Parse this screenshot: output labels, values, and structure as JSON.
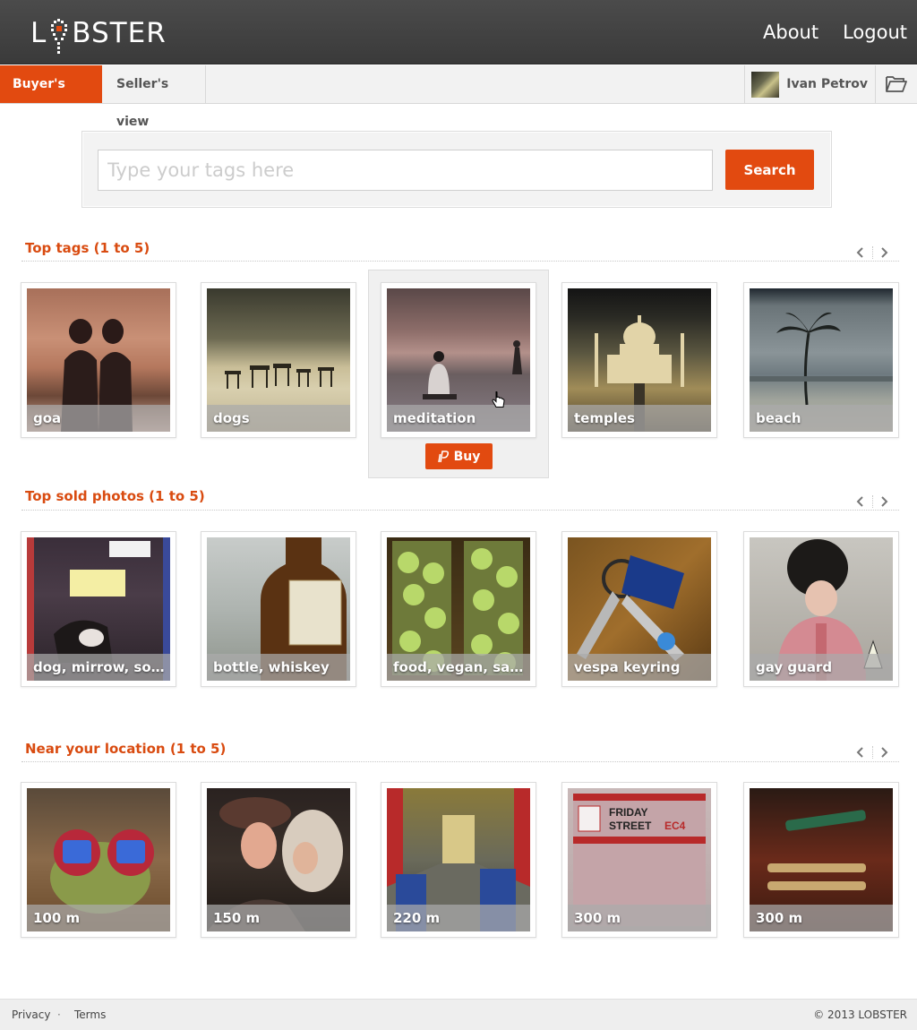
{
  "header": {
    "logo_text_left": "L",
    "logo_text_right": "BSTER",
    "nav": [
      {
        "label": "About"
      },
      {
        "label": "Logout"
      }
    ]
  },
  "tabs": {
    "buyer_label": "Buyer's view",
    "seller_label": "Seller's view"
  },
  "user": {
    "name": "Ivan Petrov"
  },
  "search": {
    "placeholder": "Type your tags here",
    "value": "",
    "button_label": "Search"
  },
  "accent_color": "#e24a10",
  "sections": [
    {
      "title": "Top tags (1 to 5)",
      "items": [
        {
          "caption": "goa"
        },
        {
          "caption": "dogs"
        },
        {
          "caption": "meditation"
        },
        {
          "caption": "temples"
        },
        {
          "caption": "beach"
        }
      ]
    },
    {
      "title": "Top sold photos (1 to 5)",
      "items": [
        {
          "caption": "dog, mirrow, sorr..."
        },
        {
          "caption": "bottle, whiskey"
        },
        {
          "caption": "food, vegan, sand..."
        },
        {
          "caption": "vespa keyring"
        },
        {
          "caption": "gay guard"
        }
      ]
    },
    {
      "title": "Near your location (1 to 5)",
      "items": [
        {
          "caption": "100 m"
        },
        {
          "caption": "150 m"
        },
        {
          "caption": "220 m"
        },
        {
          "caption": "300 m"
        },
        {
          "caption": "300 m"
        }
      ]
    }
  ],
  "buy_label": "Buy",
  "footer": {
    "privacy": "Privacy",
    "separator": "·",
    "terms": "Terms",
    "copyright": "© 2013 LOBSTER"
  }
}
